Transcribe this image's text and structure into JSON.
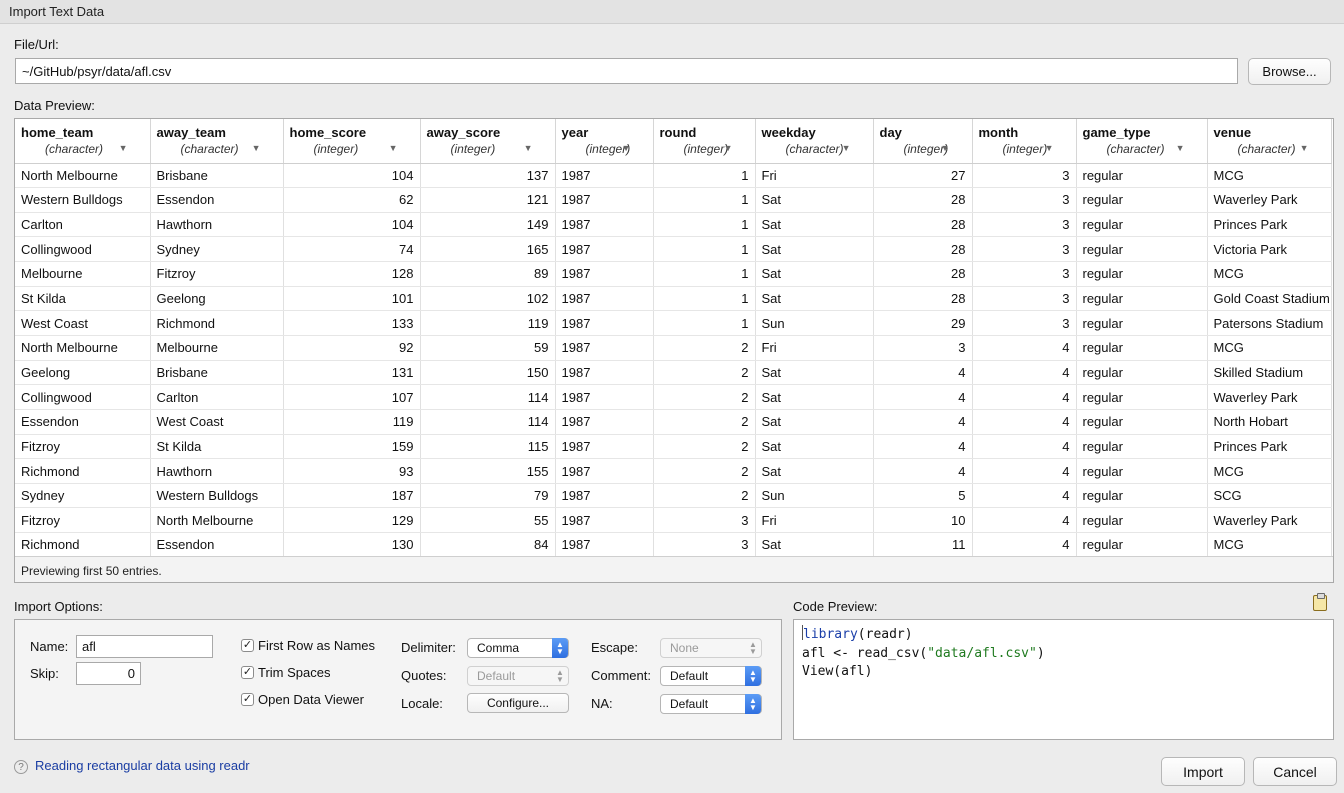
{
  "window": {
    "title": "Import Text Data"
  },
  "file": {
    "label": "File/Url:",
    "value": "~/GitHub/psyr/data/afl.csv",
    "browse_label": "Browse..."
  },
  "preview": {
    "label": "Data Preview:",
    "columns": [
      {
        "name": "home_team",
        "type": "(character)"
      },
      {
        "name": "away_team",
        "type": "(character)"
      },
      {
        "name": "home_score",
        "type": "(integer)"
      },
      {
        "name": "away_score",
        "type": "(integer)"
      },
      {
        "name": "year",
        "type": "(integer)"
      },
      {
        "name": "round",
        "type": "(integer)"
      },
      {
        "name": "weekday",
        "type": "(character)"
      },
      {
        "name": "day",
        "type": "(integer)"
      },
      {
        "name": "month",
        "type": "(integer)"
      },
      {
        "name": "game_type",
        "type": "(character)"
      },
      {
        "name": "venue",
        "type": "(character)"
      }
    ],
    "rows": [
      [
        "North Melbourne",
        "Brisbane",
        "104",
        "137",
        "1987",
        "1",
        "Fri",
        "27",
        "3",
        "regular",
        "MCG"
      ],
      [
        "Western Bulldogs",
        "Essendon",
        "62",
        "121",
        "1987",
        "1",
        "Sat",
        "28",
        "3",
        "regular",
        "Waverley Park"
      ],
      [
        "Carlton",
        "Hawthorn",
        "104",
        "149",
        "1987",
        "1",
        "Sat",
        "28",
        "3",
        "regular",
        "Princes Park"
      ],
      [
        "Collingwood",
        "Sydney",
        "74",
        "165",
        "1987",
        "1",
        "Sat",
        "28",
        "3",
        "regular",
        "Victoria Park"
      ],
      [
        "Melbourne",
        "Fitzroy",
        "128",
        "89",
        "1987",
        "1",
        "Sat",
        "28",
        "3",
        "regular",
        "MCG"
      ],
      [
        "St Kilda",
        "Geelong",
        "101",
        "102",
        "1987",
        "1",
        "Sat",
        "28",
        "3",
        "regular",
        "Gold Coast Stadium"
      ],
      [
        "West Coast",
        "Richmond",
        "133",
        "119",
        "1987",
        "1",
        "Sun",
        "29",
        "3",
        "regular",
        "Patersons Stadium"
      ],
      [
        "North Melbourne",
        "Melbourne",
        "92",
        "59",
        "1987",
        "2",
        "Fri",
        "3",
        "4",
        "regular",
        "MCG"
      ],
      [
        "Geelong",
        "Brisbane",
        "131",
        "150",
        "1987",
        "2",
        "Sat",
        "4",
        "4",
        "regular",
        "Skilled Stadium"
      ],
      [
        "Collingwood",
        "Carlton",
        "107",
        "114",
        "1987",
        "2",
        "Sat",
        "4",
        "4",
        "regular",
        "Waverley Park"
      ],
      [
        "Essendon",
        "West Coast",
        "119",
        "114",
        "1987",
        "2",
        "Sat",
        "4",
        "4",
        "regular",
        "North Hobart"
      ],
      [
        "Fitzroy",
        "St Kilda",
        "159",
        "115",
        "1987",
        "2",
        "Sat",
        "4",
        "4",
        "regular",
        "Princes Park"
      ],
      [
        "Richmond",
        "Hawthorn",
        "93",
        "155",
        "1987",
        "2",
        "Sat",
        "4",
        "4",
        "regular",
        "MCG"
      ],
      [
        "Sydney",
        "Western Bulldogs",
        "187",
        "79",
        "1987",
        "2",
        "Sun",
        "5",
        "4",
        "regular",
        "SCG"
      ],
      [
        "Fitzroy",
        "North Melbourne",
        "129",
        "55",
        "1987",
        "3",
        "Fri",
        "10",
        "4",
        "regular",
        "Waverley Park"
      ],
      [
        "Richmond",
        "Essendon",
        "130",
        "84",
        "1987",
        "3",
        "Sat",
        "11",
        "4",
        "regular",
        "MCG"
      ]
    ],
    "footer": "Previewing first 50 entries."
  },
  "options": {
    "label": "Import Options:",
    "name_label": "Name:",
    "name_value": "afl",
    "skip_label": "Skip:",
    "skip_value": "0",
    "first_row_label": "First Row as Names",
    "trim_label": "Trim Spaces",
    "open_viewer_label": "Open Data Viewer",
    "check_glyph": "✓",
    "delimiter_label": "Delimiter:",
    "delimiter_value": "Comma",
    "quotes_label": "Quotes:",
    "quotes_value": "Default",
    "locale_label": "Locale:",
    "configure_label": "Configure...",
    "escape_label": "Escape:",
    "escape_value": "None",
    "comment_label": "Comment:",
    "comment_value": "Default",
    "na_label": "NA:",
    "na_value": "Default"
  },
  "code": {
    "label": "Code Preview:",
    "line1_fn": "library",
    "line1_rest": "(readr)",
    "line2_pre": "afl <- read_csv(",
    "line2_str": "\"data/afl.csv\"",
    "line2_post": ")",
    "line3": "View(afl)"
  },
  "help": {
    "icon": "?",
    "link": "Reading rectangular data using readr"
  },
  "footer_buttons": {
    "import": "Import",
    "cancel": "Cancel"
  },
  "icons": {
    "clipboard": "clipboard-icon",
    "help": "help-icon",
    "dropdown": "chevron-updown-icon",
    "column_menu": "chevron-down-icon"
  }
}
